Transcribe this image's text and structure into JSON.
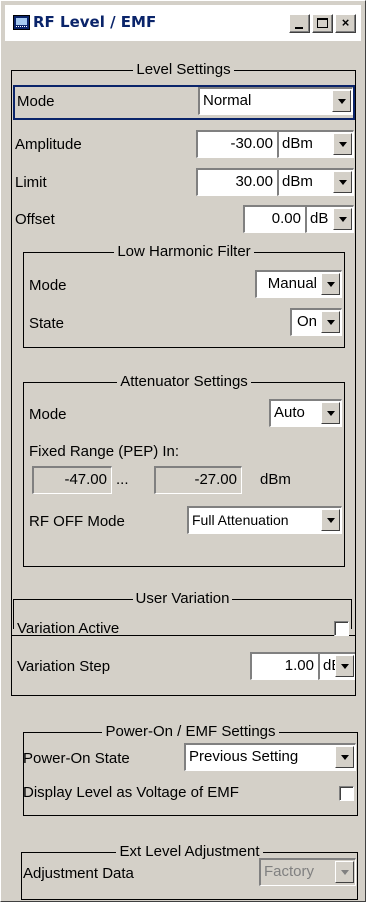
{
  "window": {
    "title": "RF Level / EMF",
    "min_label": "",
    "max_label": "",
    "close_label": "×"
  },
  "level_settings": {
    "title": "Level Settings",
    "mode_label": "Mode",
    "mode_value": "Normal",
    "amplitude_label": "Amplitude",
    "amplitude_value": "-30.00",
    "amplitude_unit": "dBm",
    "limit_label": "Limit",
    "limit_value": "30.00",
    "limit_unit": "dBm",
    "offset_label": "Offset",
    "offset_value": "0.00",
    "offset_unit": "dB"
  },
  "low_harmonic_filter": {
    "title": "Low Harmonic Filter",
    "mode_label": "Mode",
    "mode_value": "Manual",
    "state_label": "State",
    "state_value": "On"
  },
  "attenuator_settings": {
    "title": "Attenuator Settings",
    "mode_label": "Mode",
    "mode_value": "Auto",
    "fixed_range_label": "Fixed Range (PEP) In:",
    "range_min": "-47.00",
    "range_sep": "...",
    "range_max": "-27.00",
    "range_unit": "dBm",
    "rf_off_mode_label": "RF OFF Mode",
    "rf_off_mode_value": "Full Attenuation"
  },
  "user_variation": {
    "title": "User Variation",
    "active_label": "Variation Active",
    "active_checked": false,
    "step_label": "Variation Step",
    "step_value": "1.00",
    "step_unit": "dB"
  },
  "power_on_emf": {
    "title": "Power-On / EMF Settings",
    "power_on_state_label": "Power-On State",
    "power_on_state_value": "Previous Setting",
    "display_emf_label": "Display Level as Voltage of EMF",
    "display_emf_checked": false
  },
  "ext_level_adjustment": {
    "title": "Ext Level Adjustment",
    "adjustment_data_label": "Adjustment Data",
    "adjustment_data_value": "Factory"
  }
}
